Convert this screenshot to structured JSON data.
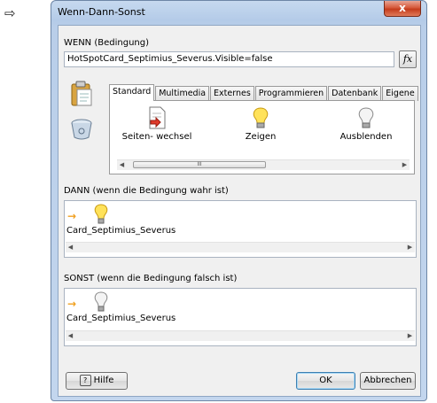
{
  "outer": {
    "arrow_glyph": "⇨"
  },
  "window": {
    "title": "Wenn-Dann-Sonst",
    "close_glyph": "x"
  },
  "wenn": {
    "label": "WENN (Bedingung)",
    "value": "HotSpotCard_Septimius_Severus.Visible=false",
    "fx_label": "fx"
  },
  "tabs": [
    {
      "label": "Standard",
      "active": true
    },
    {
      "label": "Multimedia",
      "active": false
    },
    {
      "label": "Externes",
      "active": false
    },
    {
      "label": "Programmieren",
      "active": false
    },
    {
      "label": "Datenbank",
      "active": false
    },
    {
      "label": "Eigene",
      "active": false
    }
  ],
  "tools": [
    {
      "label": "Seiten- wechsel",
      "icon": "page-change-icon"
    },
    {
      "label": "Zeigen",
      "icon": "bulb-on-icon"
    },
    {
      "label": "Ausblenden",
      "icon": "bulb-off-icon"
    }
  ],
  "scroll_thumb_glyph": "III",
  "dann": {
    "label": "DANN (wenn die Bedingung wahr ist)",
    "item_label": "Card_Septimius_Severus"
  },
  "sonst": {
    "label": "SONST (wenn die Bedingung falsch ist)",
    "item_label": "Card_Septimius_Severus"
  },
  "buttons": {
    "help_icon_glyph": "?",
    "help": "Hilfe",
    "ok": "OK",
    "cancel": "Abbrechen"
  },
  "colors": {
    "accent_arrow": "#f0a020",
    "close_red": "#c43c1c",
    "bulb_on": "#ffe25a"
  }
}
